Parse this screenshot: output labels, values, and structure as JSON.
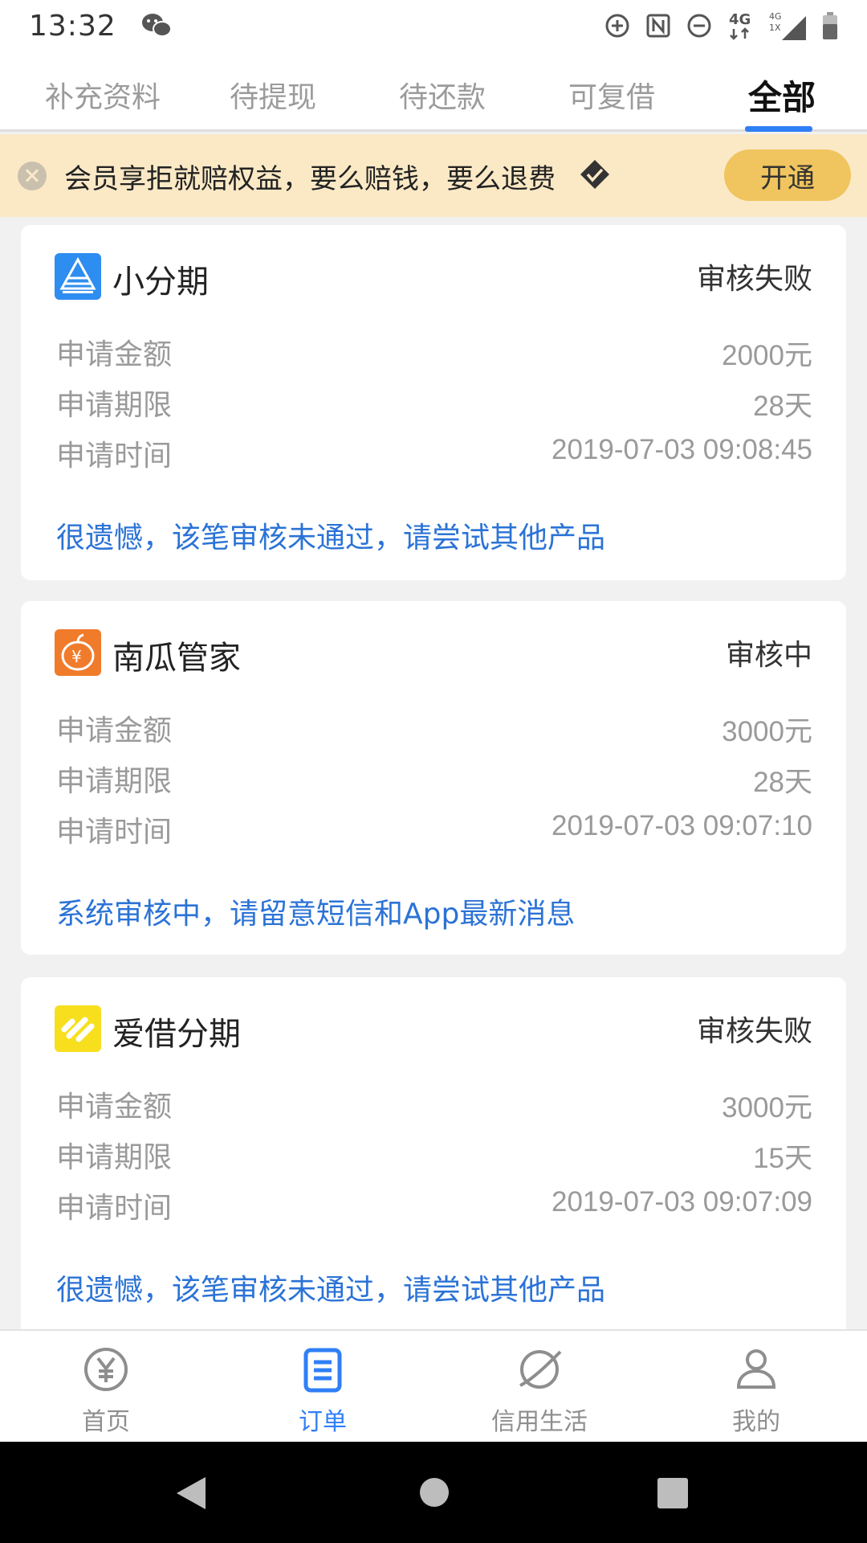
{
  "status_bar": {
    "time": "13:32",
    "icons": [
      "wechat-icon",
      "data-saver-icon",
      "nfc-icon",
      "dnd-icon",
      "4g-icon",
      "signal-icon",
      "battery-icon"
    ]
  },
  "tabs": [
    {
      "label": "补充资料",
      "active": false
    },
    {
      "label": "待提现",
      "active": false
    },
    {
      "label": "待还款",
      "active": false
    },
    {
      "label": "可复借",
      "active": false
    },
    {
      "label": "全部",
      "active": true
    }
  ],
  "banner": {
    "text": "会员享拒就赔权益，要么赔钱，要么退费",
    "button": "开通"
  },
  "orders": [
    {
      "name": "小分期",
      "status": "审核失败",
      "amount_label": "申请金额",
      "amount": "2000元",
      "term_label": "申请期限",
      "term": "28天",
      "time_label": "申请时间",
      "time": "2019-07-03 09:08:45",
      "note": "很遗憾，该笔审核未通过，请尝试其他产品",
      "logo_color": "#2e8df0"
    },
    {
      "name": "南瓜管家",
      "status": "审核中",
      "amount_label": "申请金额",
      "amount": "3000元",
      "term_label": "申请期限",
      "term": "28天",
      "time_label": "申请时间",
      "time": "2019-07-03 09:07:10",
      "note": "系统审核中，请留意短信和App最新消息",
      "logo_color": "#f07b2a"
    },
    {
      "name": "爱借分期",
      "status": "审核失败",
      "amount_label": "申请金额",
      "amount": "3000元",
      "term_label": "申请期限",
      "term": "15天",
      "time_label": "申请时间",
      "time": "2019-07-03 09:07:09",
      "note": "很遗憾，该笔审核未通过，请尝试其他产品",
      "logo_color": "#f7df1e"
    }
  ],
  "bottom_nav": [
    {
      "label": "首页",
      "icon": "yen-coin-icon",
      "active": false
    },
    {
      "label": "订单",
      "icon": "order-list-icon",
      "active": true
    },
    {
      "label": "信用生活",
      "icon": "planet-icon",
      "active": false
    },
    {
      "label": "我的",
      "icon": "person-icon",
      "active": false
    }
  ],
  "colors": {
    "accent": "#2f7ff6",
    "note_blue": "#2b73d6",
    "banner_bg": "#fbe9c6",
    "banner_button": "#f0c45e"
  }
}
